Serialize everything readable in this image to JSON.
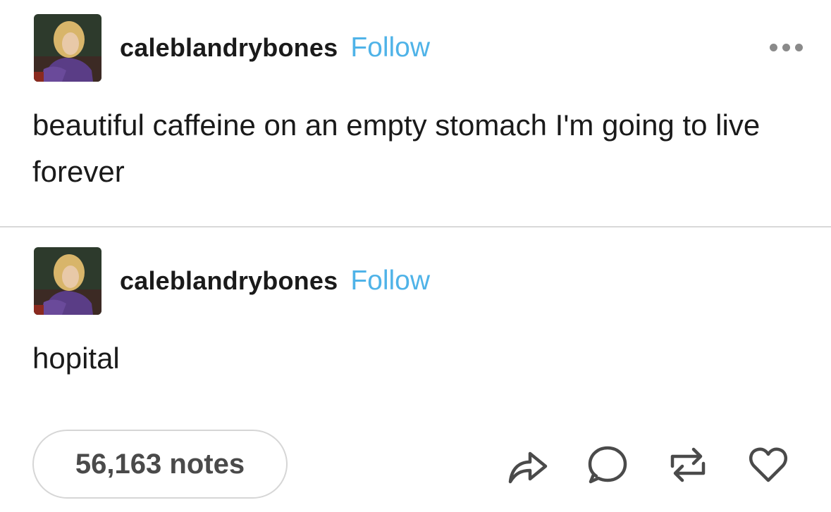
{
  "posts": [
    {
      "username": "caleblandrybones",
      "follow_label": "Follow",
      "text": "beautiful caffeine on an empty stomach I'm going to live forever"
    },
    {
      "username": "caleblandrybones",
      "follow_label": "Follow",
      "text": "hopital"
    }
  ],
  "footer": {
    "notes_label": "56,163 notes"
  },
  "icons": {
    "more": "more-options-icon",
    "share": "share-icon",
    "reply": "reply-icon",
    "reblog": "reblog-icon",
    "like": "heart-icon"
  },
  "colors": {
    "follow": "#4fb3e8",
    "text": "#1a1a1a",
    "icon": "#4a4a4a",
    "divider": "#d9d9d9"
  }
}
